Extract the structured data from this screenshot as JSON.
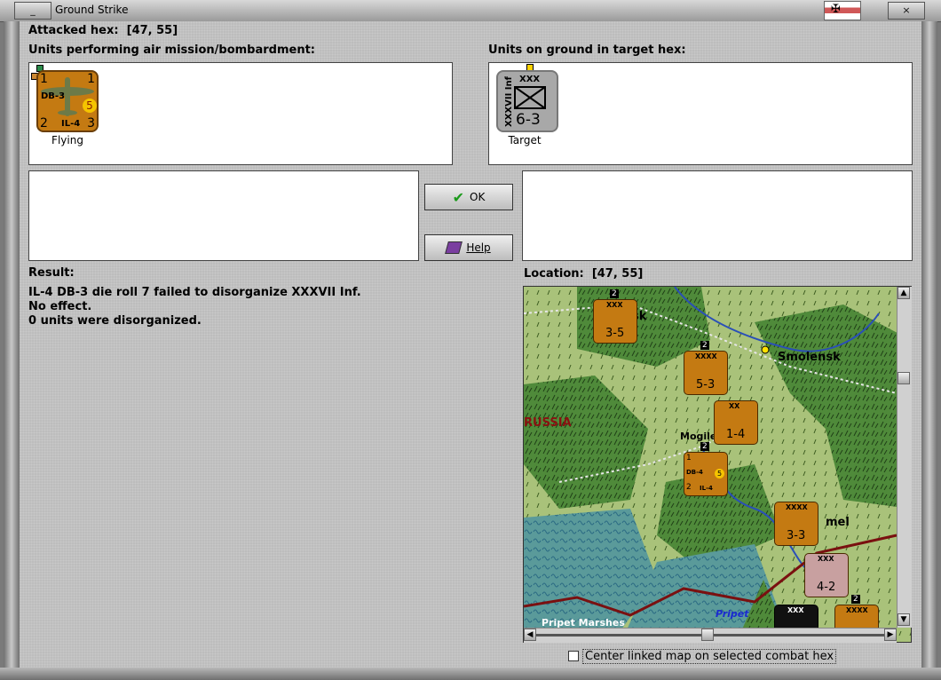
{
  "window": {
    "title": "Ground Strike",
    "minimize_label": "_",
    "close_label": "×"
  },
  "attacked": {
    "label": "Attacked hex:",
    "value": "[47, 55]"
  },
  "air_units": {
    "header": "Units performing air mission/bombardment:",
    "items": [
      {
        "top_left": "1",
        "top_right": "1",
        "name": "DB-3",
        "strength": "5",
        "bottom_left": "2",
        "type": "IL-4",
        "bottom_right": "3",
        "caption": "Flying"
      }
    ]
  },
  "ground_units": {
    "header": "Units on ground in target hex:",
    "items": [
      {
        "size": "XXX",
        "side_name": "XXXVII Inf",
        "factors": "6-3",
        "caption": "Target"
      }
    ]
  },
  "buttons": {
    "ok": "OK",
    "help": "Help"
  },
  "result": {
    "label": "Result:",
    "lines": [
      "IL-4 DB-3 die roll 7 failed to disorganize XXXVII Inf.",
      "No effect.",
      "0 units were disorganized."
    ]
  },
  "location": {
    "label": "Location:",
    "value": "[47, 55]"
  },
  "map": {
    "places": [
      "Smolensk",
      "RUSSIA",
      "Mogile",
      "mel",
      "sk",
      "Pripet",
      "Pripet Marshes"
    ],
    "counters": [
      {
        "size": "XXX",
        "factors": "3-5",
        "stack": "2"
      },
      {
        "size": "XXXX",
        "factors": "5-3",
        "stack": "2"
      },
      {
        "size": "XX",
        "factors": "1-4"
      },
      {
        "size": "",
        "factors": "",
        "stack": "2",
        "air_top": "1",
        "air_name": "DB-4",
        "air_str": "5",
        "air_bottom": "2",
        "air_type": "IL-4"
      },
      {
        "size": "XXXX",
        "factors": "3-3"
      },
      {
        "size": "XXX",
        "factors": "4-2"
      },
      {
        "size": "XXX",
        "factors": ""
      },
      {
        "size": "XXXX",
        "factors": "",
        "stack": "2"
      }
    ]
  },
  "checkbox": {
    "label": "Center linked map on selected combat hex",
    "checked": false
  },
  "colors": {
    "counter_orange": "#c47a12",
    "counter_grey": "#a8a8a8",
    "forest": "#4f8a3a",
    "clear": "#a9c27a",
    "marsh": "#5a9a9a"
  }
}
